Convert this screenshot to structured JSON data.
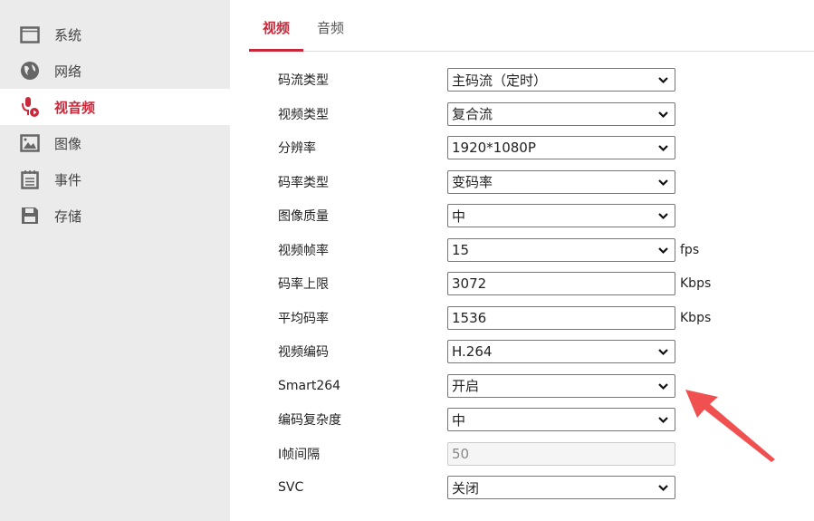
{
  "sidebar": {
    "items": [
      {
        "label": "系统",
        "icon": "window-icon"
      },
      {
        "label": "网络",
        "icon": "globe-icon"
      },
      {
        "label": "视音频",
        "icon": "microphone-icon",
        "active": true
      },
      {
        "label": "图像",
        "icon": "image-icon"
      },
      {
        "label": "事件",
        "icon": "calendar-icon"
      },
      {
        "label": "存储",
        "icon": "floppy-icon"
      }
    ]
  },
  "tabs": [
    {
      "label": "视频",
      "active": true
    },
    {
      "label": "音频"
    }
  ],
  "form": [
    {
      "label": "码流类型",
      "value": "主码流（定时）",
      "type": "select",
      "unit": ""
    },
    {
      "label": "视频类型",
      "value": "复合流",
      "type": "select",
      "unit": ""
    },
    {
      "label": "分辨率",
      "value": "1920*1080P",
      "type": "select",
      "unit": ""
    },
    {
      "label": "码率类型",
      "value": "变码率",
      "type": "select",
      "unit": ""
    },
    {
      "label": "图像质量",
      "value": "中",
      "type": "select",
      "unit": ""
    },
    {
      "label": "视频帧率",
      "value": "15",
      "type": "select",
      "unit": "fps"
    },
    {
      "label": "码率上限",
      "value": "3072",
      "type": "input",
      "unit": "Kbps"
    },
    {
      "label": "平均码率",
      "value": "1536",
      "type": "input",
      "unit": "Kbps"
    },
    {
      "label": "视频编码",
      "value": "H.264",
      "type": "select",
      "unit": ""
    },
    {
      "label": "Smart264",
      "value": "开启",
      "type": "select",
      "unit": ""
    },
    {
      "label": "编码复杂度",
      "value": "中",
      "type": "select",
      "unit": ""
    },
    {
      "label": "I帧间隔",
      "value": "50",
      "type": "disabled",
      "unit": ""
    },
    {
      "label": "SVC",
      "value": "关闭",
      "type": "select",
      "unit": ""
    }
  ],
  "colors": {
    "accent": "#c8283a",
    "arrow": "#f05050"
  }
}
